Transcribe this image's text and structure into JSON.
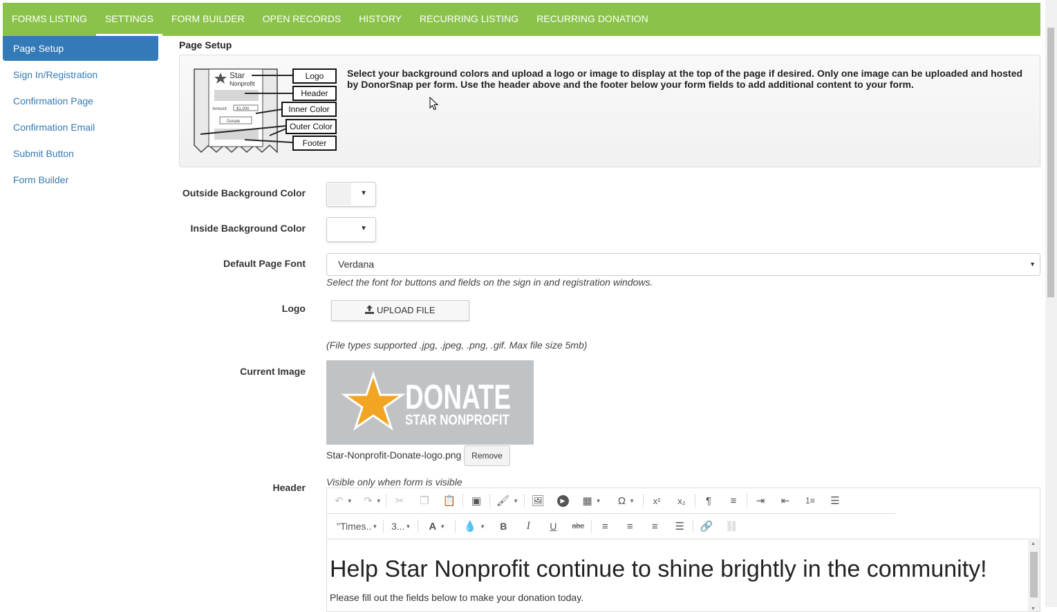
{
  "nav": {
    "tabs": [
      {
        "label": "FORMS LISTING"
      },
      {
        "label": "SETTINGS",
        "active": true
      },
      {
        "label": "FORM BUILDER"
      },
      {
        "label": "OPEN RECORDS"
      },
      {
        "label": "HISTORY"
      },
      {
        "label": "RECURRING LISTING"
      },
      {
        "label": "RECURRING DONATION"
      }
    ],
    "accent_color": "#8bc34a"
  },
  "sidebar": {
    "items": [
      {
        "label": "Page Setup",
        "active": true
      },
      {
        "label": "Sign In/Registration"
      },
      {
        "label": "Confirmation Page"
      },
      {
        "label": "Confirmation Email"
      },
      {
        "label": "Submit Button"
      },
      {
        "label": "Form Builder"
      }
    ],
    "active_color": "#337ab7"
  },
  "page": {
    "section_title": "Page Setup",
    "info_text": "Select your background colors and upload a logo or image to display at the top of the page if desired. Only one image can be uploaded and hosted by DonorSnap per form. Use the header above and the footer below your form fields to add additional content to your form.",
    "diagram": {
      "brand_line1": "Star",
      "brand_line2": "Nonprofit",
      "amount_label": "Amount:",
      "amount_value": "$1,000",
      "donate_label": "Donate",
      "callouts": [
        "Logo",
        "Header",
        "Inner Color",
        "Outer Color",
        "Footer"
      ]
    }
  },
  "form": {
    "outside_bg": {
      "label": "Outside Background Color",
      "value": "#f1f1f1"
    },
    "inside_bg": {
      "label": "Inside Background Color",
      "value": "#ffffff"
    },
    "font": {
      "label": "Default Page Font",
      "value": "Verdana",
      "hint": "Select the font for buttons and fields on the sign in and registration windows."
    },
    "logo": {
      "label": "Logo",
      "upload_label": "UPLOAD FILE",
      "hint": "(File types supported .jpg, .jpeg, .png, .gif. Max file size 5mb)"
    },
    "current_image": {
      "label": "Current Image",
      "image_text_line1": "DONATE",
      "image_text_line2": "STAR NONPROFIT",
      "filename": "Star-Nonprofit-Donate-logo.png",
      "remove_label": "Remove"
    },
    "header": {
      "label": "Header",
      "hint": "Visible only when form is visible",
      "toolbar": {
        "font_family": "\"Times..",
        "font_size": "3..."
      },
      "content_heading": "Help Star Nonprofit continue to shine brightly in the community!",
      "content_text": "Please fill out the fields below to make your donation today."
    }
  }
}
